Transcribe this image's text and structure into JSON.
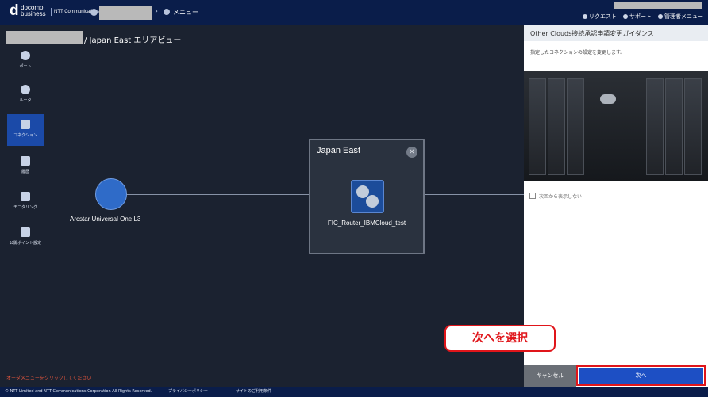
{
  "header": {
    "logo_mark": "d",
    "logo_line1": "docomo",
    "logo_line2": "business",
    "logo_partner": "NTT Communications",
    "menu_label": "メニュー",
    "links": [
      "リクエスト",
      "サポート",
      "管理者メニュー"
    ]
  },
  "area": {
    "title": "/ Japan East エリアビュー"
  },
  "sidebar": {
    "items": [
      {
        "label": "ポート"
      },
      {
        "label": "ルータ"
      },
      {
        "label": "コネクション"
      },
      {
        "label": "履歴"
      },
      {
        "label": "モニタリング"
      },
      {
        "label": "公開ポイント設定"
      }
    ]
  },
  "canvas": {
    "node_left_label": "Arcstar Universal One L3",
    "popup_title": "Japan East",
    "popup_close": "×",
    "router_label": "FIC_Router_IBMCloud_test"
  },
  "hint": "オーダメニューをクリックしてください",
  "panel": {
    "title": "Other Clouds接続承認申請変更ガイダンス",
    "description": "指定したコネクションの設定を変更します。",
    "no_show": "次回から表示しない",
    "cancel": "キャンセル",
    "next": "次へ"
  },
  "callout": "次へを選択",
  "footer": {
    "copyright": "© NTT Limited and NTT Communications Corporation All Rights Reserved.",
    "privacy": "プライバシーポリシー",
    "terms": "サイトのご利用条件"
  }
}
